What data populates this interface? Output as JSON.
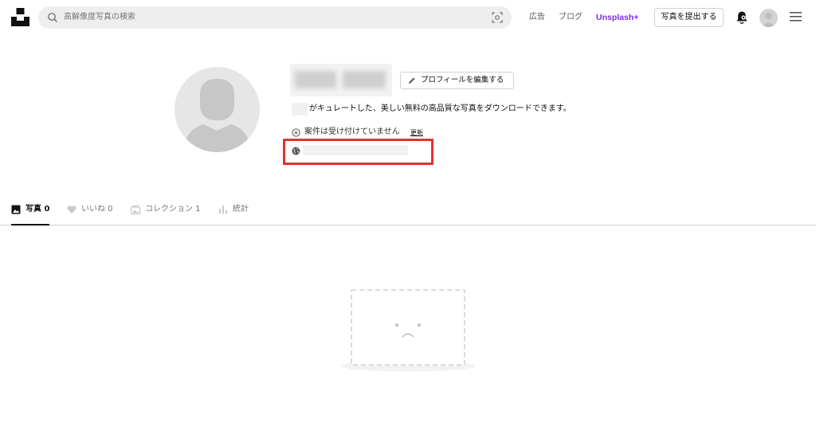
{
  "header": {
    "logo": "unsplash-logo",
    "search": {
      "placeholder": "高解像度写真の検索",
      "icon": "search-icon",
      "visual_search_icon": "lens-icon"
    },
    "nav": {
      "ads": "広告",
      "blog": "ブログ",
      "plus": "Unsplash+"
    },
    "submit_button": "写真を提出する",
    "icons": [
      "bell-icon",
      "avatar",
      "menu-icon"
    ]
  },
  "profile": {
    "name": "",
    "edit_button": "プロフィールを編集する",
    "bio": "がキュレートした、美しい無料の高品質な写真をダウンロードできます。",
    "hire_status": "案件は受け付けていません",
    "update_link": "更新",
    "website": ""
  },
  "tabs": [
    {
      "label": "写真 0",
      "icon": "photo-icon",
      "active": true
    },
    {
      "label": "いいね 0",
      "icon": "heart-icon",
      "active": false
    },
    {
      "label": "コレクション 1",
      "icon": "collection-icon",
      "active": false
    },
    {
      "label": "統計",
      "icon": "stats-icon",
      "active": false
    }
  ],
  "colors": {
    "accent_plus": "#7d2ae8",
    "highlight_border": "#e5322d",
    "tab_active": "#111111"
  }
}
